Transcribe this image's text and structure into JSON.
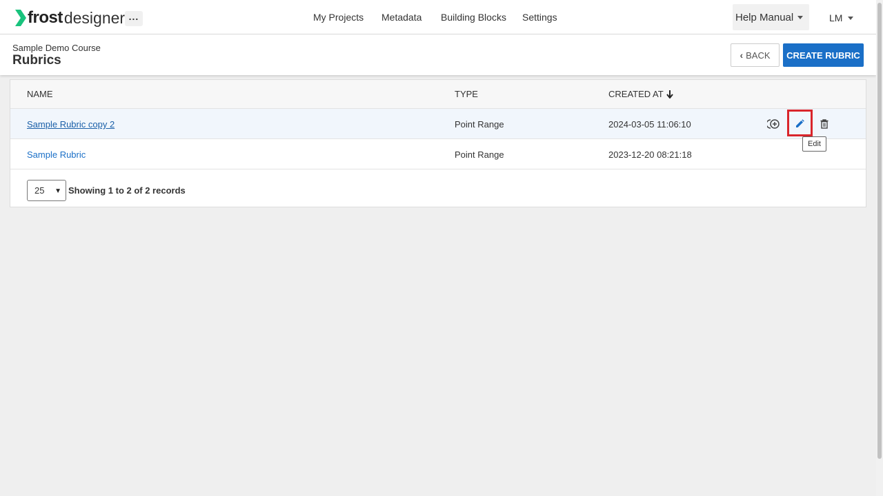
{
  "brand": {
    "name_bold": "frost",
    "name_light": "designer",
    "accent": "#19c37d"
  },
  "nav": {
    "more_label": "...",
    "links": [
      "My Projects",
      "Metadata",
      "Building Blocks",
      "Settings"
    ],
    "help_label": "Help Manual",
    "user_initials": "LM"
  },
  "header": {
    "course": "Sample Demo Course",
    "title": "Rubrics",
    "back_label": "BACK",
    "create_label": "CREATE RUBRIC"
  },
  "table": {
    "columns": [
      "NAME",
      "TYPE",
      "CREATED AT"
    ],
    "sort_icon": "arrow-down-icon",
    "rows": [
      {
        "name": "Sample Rubric copy 2",
        "type": "Point Range",
        "created_at": "2024-03-05 11:06:10"
      },
      {
        "name": "Sample Rubric",
        "type": "Point Range",
        "created_at": "2023-12-20 08:21:18"
      }
    ],
    "tooltip": "Edit",
    "page_size": "25",
    "records_text": "Showing 1 to 2 of 2 records"
  },
  "colors": {
    "primary": "#1a6fc7",
    "highlight": "#d9252b"
  }
}
